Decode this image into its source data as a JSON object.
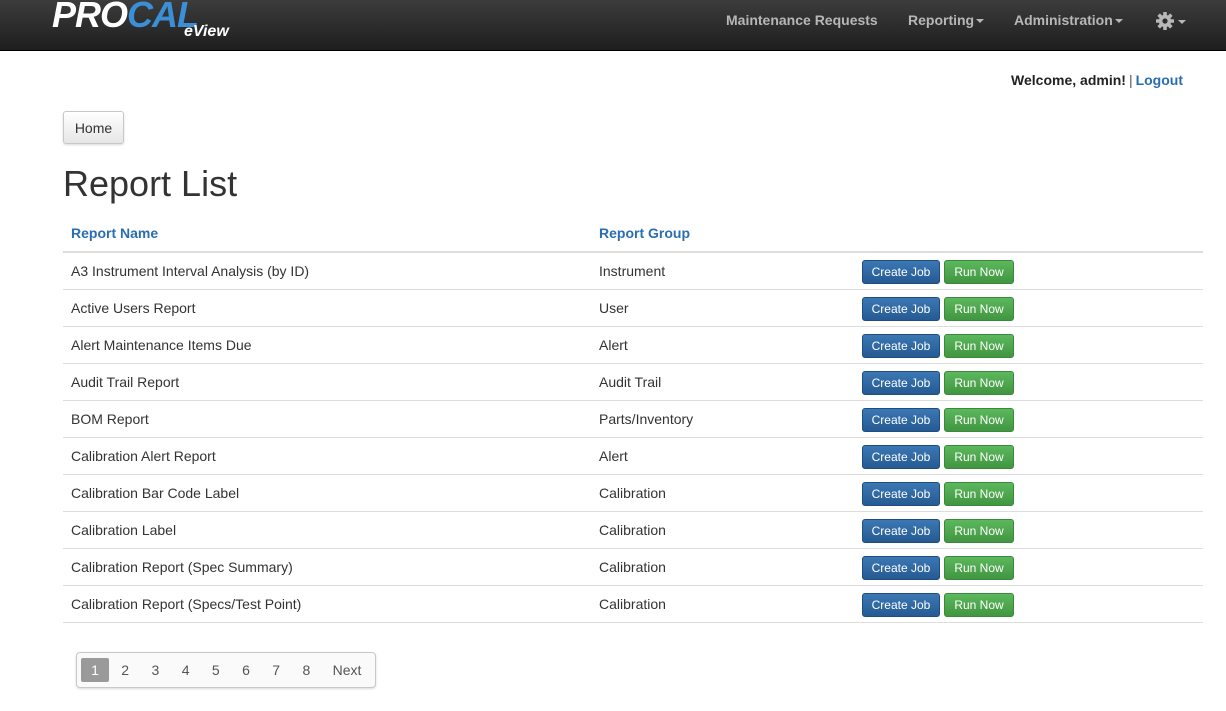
{
  "brand": {
    "pro": "PRO",
    "cal": "CAL",
    "sub": "eView"
  },
  "nav": {
    "maintenance_requests": "Maintenance Requests",
    "reporting": "Reporting",
    "administration": "Administration",
    "settings_icon": "gear-icon"
  },
  "welcome": {
    "text": "Welcome, admin!",
    "separator": "|",
    "logout": "Logout"
  },
  "breadcrumb": {
    "home": "Home"
  },
  "page_title": "Report List",
  "table": {
    "headers": {
      "name": "Report Name",
      "group": "Report Group"
    },
    "create_label": "Create Job",
    "run_label": "Run Now",
    "rows": [
      {
        "name": "A3 Instrument Interval Analysis (by ID)",
        "group": "Instrument"
      },
      {
        "name": "Active Users Report",
        "group": "User"
      },
      {
        "name": "Alert Maintenance Items Due",
        "group": "Alert"
      },
      {
        "name": "Audit Trail Report",
        "group": "Audit Trail"
      },
      {
        "name": "BOM Report",
        "group": "Parts/Inventory"
      },
      {
        "name": "Calibration Alert Report",
        "group": "Alert"
      },
      {
        "name": "Calibration Bar Code Label",
        "group": "Calibration"
      },
      {
        "name": "Calibration Label",
        "group": "Calibration"
      },
      {
        "name": "Calibration Report (Spec Summary)",
        "group": "Calibration"
      },
      {
        "name": "Calibration Report (Specs/Test Point)",
        "group": "Calibration"
      }
    ]
  },
  "pagination": {
    "pages": [
      "1",
      "2",
      "3",
      "4",
      "5",
      "6",
      "7",
      "8"
    ],
    "active": "1",
    "next": "Next"
  },
  "colors": {
    "navbar": "#2b2b2b",
    "link": "#2a6eb2",
    "create_button": "#2f6ba8",
    "run_button": "#4cae4c"
  }
}
